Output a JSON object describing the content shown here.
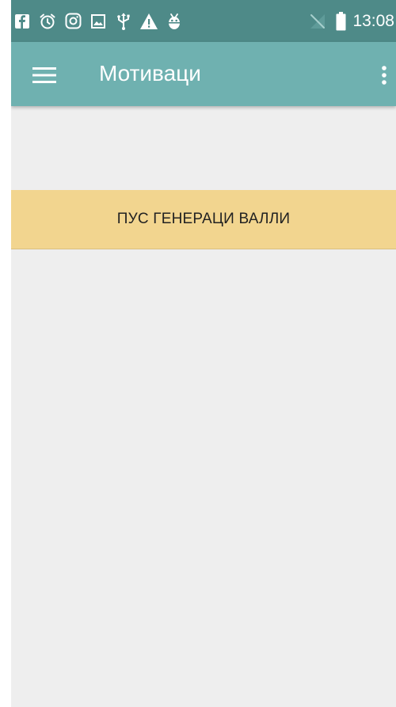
{
  "status_bar": {
    "time": "13:08",
    "left_icons": [
      "facebook-icon",
      "alarm-icon",
      "instagram-icon",
      "gallery-icon",
      "usb-icon",
      "warning-icon",
      "android-debug-icon"
    ],
    "right_icons": [
      "no-signal-icon",
      "battery-icon"
    ],
    "background_color": "#4e8a88"
  },
  "app_bar": {
    "title": "Мотиваци",
    "menu_icon": "hamburger-menu-icon",
    "overflow_icon": "more-vertical-icon",
    "background_color": "#6fb1b0"
  },
  "main": {
    "generate_button_label": "ПУС ГЕНЕРАЦИ ВАЛЛИ",
    "button_color": "#f2d58f",
    "background_color": "#eeeeee"
  }
}
